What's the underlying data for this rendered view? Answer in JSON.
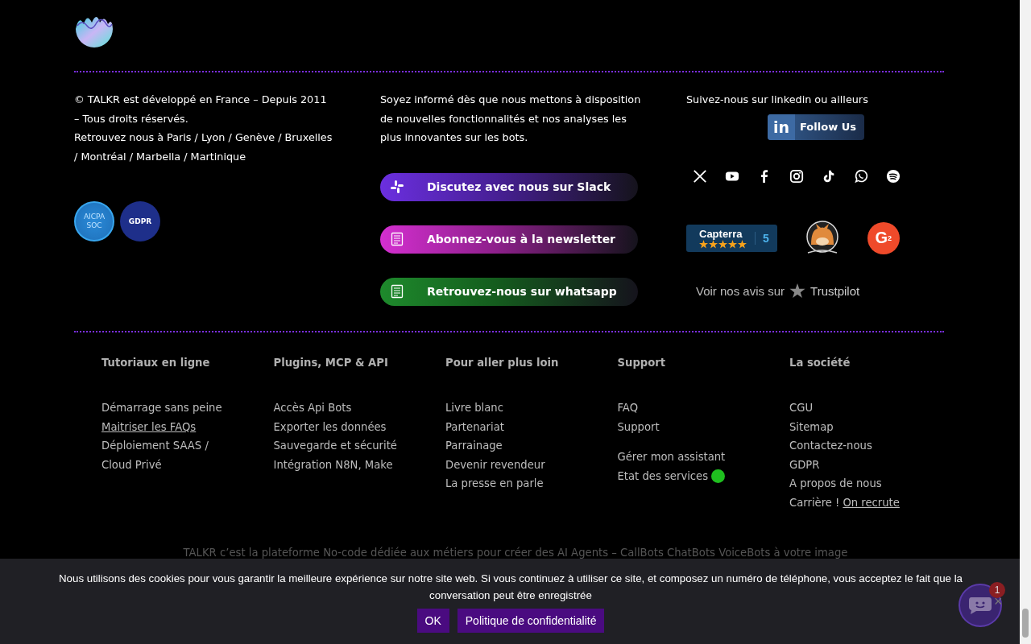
{
  "about": {
    "lines": [
      "© TALKR est développé en France – Depuis 2011",
      "–  Tous droits réservés.",
      "Retrouvez nous à Paris / Lyon / Genève / Bruxelles",
      "/ Montréal / Marbella / Martinique"
    ],
    "certifications": [
      {
        "kind": "soc",
        "lines": [
          "AICPA",
          "SOC"
        ]
      },
      {
        "kind": "gdpr",
        "lines": [
          "GDPR"
        ]
      }
    ]
  },
  "newsletter": {
    "lines": [
      "Soyez informé dès que nous mettons à disposition",
      "de nouvelles fonctionnalités et nos analyses les",
      "plus innovantes sur les bots."
    ],
    "buttons": [
      {
        "kind": "slack",
        "label": "Discutez avec nous sur Slack",
        "color": "#6b2fe0"
      },
      {
        "kind": "document",
        "label": "Abonnez-vous à la newsletter",
        "color": "#d42fd0"
      },
      {
        "kind": "document",
        "label": "Retrouvez-nous sur whatsapp",
        "color": "#1e8a2c"
      }
    ]
  },
  "social": {
    "title": "Suivez-nous sur linkedin ou ailleurs",
    "linkedin": {
      "logo": "in",
      "label": "Follow Us"
    },
    "networks": [
      {
        "kind": "x"
      },
      {
        "kind": "youtube"
      },
      {
        "kind": "facebook"
      },
      {
        "kind": "instagram"
      },
      {
        "kind": "tiktok"
      },
      {
        "kind": "whatsapp"
      },
      {
        "kind": "spotify"
      }
    ],
    "reviews": [
      {
        "kind": "capterra",
        "name": "Capterra",
        "score": "5",
        "stars": 5
      },
      {
        "kind": "picture"
      },
      {
        "kind": "g2",
        "name": "G",
        "sup": "2"
      }
    ],
    "trustpilot": {
      "prefix": "Voir nos avis sur",
      "name": "Trustpilot"
    }
  },
  "link_columns": [
    {
      "title": "Tutoriaux en ligne",
      "groups": [
        [
          {
            "label": "Démarrage sans peine",
            "underlined": false
          },
          {
            "label": "Maitriser les FAQs",
            "underlined": true
          },
          {
            "label": "Déploiement SAAS /",
            "underlined": false
          },
          {
            "label": "Cloud Privé",
            "underlined": false
          }
        ]
      ]
    },
    {
      "title": "Plugins, MCP & API",
      "groups": [
        [
          {
            "label": "Accès Api Bots",
            "underlined": false
          },
          {
            "label": "Exporter les données",
            "underlined": false
          },
          {
            "label": "Sauvegarde et sécurité",
            "underlined": false
          },
          {
            "label": "Intégration N8N, Make",
            "underlined": false
          }
        ]
      ]
    },
    {
      "title": "Pour aller plus loin",
      "groups": [
        [
          {
            "label": "Livre blanc",
            "underlined": false
          },
          {
            "label": "Partenariat",
            "underlined": false
          },
          {
            "label": "Parrainage",
            "underlined": false
          },
          {
            "label": "Devenir revendeur",
            "underlined": false
          },
          {
            "label": "La presse en parle",
            "underlined": false
          }
        ]
      ]
    },
    {
      "title": "Support",
      "groups": [
        [
          {
            "label": "FAQ",
            "underlined": false
          },
          {
            "label": "Support",
            "underlined": false
          }
        ],
        [
          {
            "label": "Gérer mon assistant",
            "underlined": false
          },
          {
            "label": "Etat des services",
            "underlined": false,
            "color": "#1fbf1f"
          }
        ]
      ]
    },
    {
      "title": "La société",
      "groups": [
        [
          {
            "label": "CGU",
            "underlined": false
          },
          {
            "label": "Sitemap",
            "underlined": false
          },
          {
            "label": "Contactez-nous",
            "underlined": false
          },
          {
            "label": "GDPR",
            "underlined": false
          },
          {
            "label": "A propos de nous",
            "underlined": false
          },
          {
            "label": "Carrière !",
            "underlined": false,
            "link": "On recrute"
          }
        ]
      ]
    }
  ],
  "legal": {
    "lines": [
      "TALKR c’est la plateforme  No-code dédiée aux métiers pour créer des AI Agents – CallBots ChatBots VoiceBots à votre image"
    ]
  },
  "cookie_banner": {
    "text": "Nous utilisons des cookies pour vous garantir la meilleure expérience sur notre site web. Si vous continuez à utiliser ce site, et composez un numéro de téléphone, vous acceptez le fait que la conversation peut être enregistrée",
    "buttons": [
      "OK",
      "Politique de confidentialité"
    ]
  },
  "chat_widget": {
    "badge": "1",
    "close": "×"
  }
}
